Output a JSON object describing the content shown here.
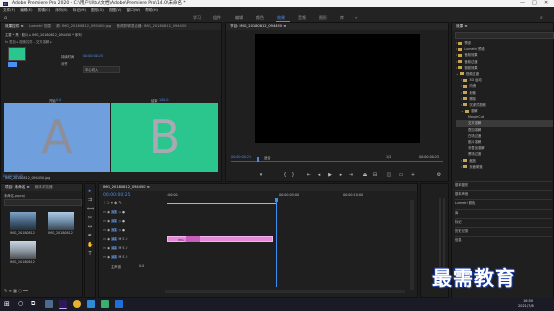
{
  "app": {
    "title": "Adobe Premiere Pro 2020 - C:\\用户\\ll\\tu\\文档\\Adobe\\Premiere Pro\\14.0\\未命名 *",
    "window_controls": [
      "—",
      "□",
      "✕"
    ]
  },
  "menu": [
    "文件(F)",
    "编辑(E)",
    "剪辑(C)",
    "序列(S)",
    "标记(M)",
    "图形(G)",
    "视图(V)",
    "窗口(W)",
    "帮助(H)"
  ],
  "workspaces": [
    {
      "label": "学习",
      "active": false
    },
    {
      "label": "组件",
      "active": false
    },
    {
      "label": "编辑",
      "active": false
    },
    {
      "label": "颜色",
      "active": false
    },
    {
      "label": "效果",
      "active": true
    },
    {
      "label": "音频",
      "active": false
    },
    {
      "label": "图形",
      "active": false
    },
    {
      "label": "库",
      "active": false
    },
    {
      "label": "»",
      "active": false
    }
  ],
  "effect_controls": {
    "tabs": [
      "效果控件 ≡",
      "Lumetri 范围",
      "源: IMG_20180812_095400.jpg",
      "音频剪辑混合器: IMG_20180812_094450"
    ],
    "source_line": "主要 * 黑 · 胶片 ▸ IMG_20180812_094450 * 序列",
    "fx_row": "fx 叠加 ▸ 图像控件 - 交叉溶解 ▸",
    "transition_label": "持续时间",
    "duration_value": "00:00:00:25",
    "align_label": "对齐",
    "align_value": "中心切入",
    "start_label": "开始",
    "start_value": "0.0",
    "end_label": "结束",
    "end_value": "100.0",
    "preview_a": "A",
    "preview_b": "B",
    "ref_line": "IMG_20180812_094450.jpg",
    "timecode": "00:00:00:25"
  },
  "program_monitor": {
    "tab_label": "节目: IMG_20180812_094450 ≡",
    "timecode_left": "00:00:00:21",
    "fit_label": "适合",
    "scale_label": "1/2",
    "timecode_right": "00:00:00:25"
  },
  "effects_panel": {
    "title": "效果 ≡",
    "tree": [
      "预设",
      "Lumetri 预设",
      "音频效果",
      "音频过渡",
      "视频效果",
      "视频过渡",
      "3D 运动",
      "内滑",
      "划像",
      "擦除",
      "沉浸式视频",
      "溶解",
      "MorphCut",
      "交叉溶解",
      "叠加溶解",
      "白场过渡",
      "胶片溶解",
      "非叠加溶解",
      "黑场过渡",
      "缩放",
      "页面剥落"
    ],
    "sections": [
      "基本图形",
      "基本声音",
      "Lumetri 颜色",
      "库",
      "标记",
      "历史记录",
      "信息"
    ]
  },
  "project_panel": {
    "tabs": [
      "项目: 未命名 ≡",
      "媒体浏览器"
    ],
    "project_file": "未命名.prproj",
    "items": [
      "IMG_20180812",
      "IMG_20180812",
      "IMG_20180812"
    ]
  },
  "timeline": {
    "tab_label": "IMG_20180812_094450 ≡",
    "timecode": "00:00:00:25",
    "ruler": [
      ":00:00",
      "00:00:05:00",
      "00:00:10:00"
    ],
    "tracks": [
      "V3",
      "V2",
      "V1",
      "A1",
      "A2",
      "A3"
    ],
    "clip_label": "IMG_20180",
    "master_label": "主声道",
    "master_value": "0.0"
  },
  "taskbar": {
    "time": "16:50",
    "date": "2021/7/6"
  },
  "watermark": "最需教育",
  "colors": {
    "accent": "#4d8ef0",
    "clip": "#e48ad8",
    "tile_a": "#6f9fdc",
    "tile_b": "#2bc58e",
    "playhead": "#3b8ff0"
  }
}
